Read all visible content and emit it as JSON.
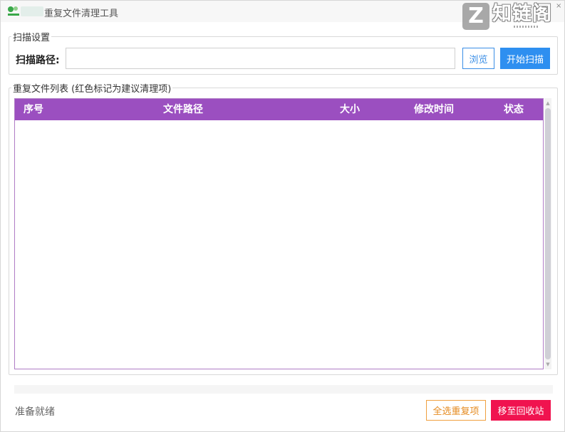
{
  "window": {
    "title": "重复文件清理工具"
  },
  "watermark": {
    "logo_letter": "Z",
    "brand_text": "知链阁"
  },
  "scan_settings": {
    "legend": "扫描设置",
    "path_label": "扫描路径:",
    "path_value": "",
    "browse_label": "浏览",
    "scan_label": "开始扫描"
  },
  "file_list": {
    "legend": "重复文件列表 (红色标记为建议清理项)",
    "columns": [
      "序号",
      "文件路径",
      "大小",
      "修改时间",
      "状态"
    ],
    "rows": []
  },
  "footer": {
    "status_text": "准备就绪",
    "progress": 0,
    "select_all_label": "全选重复项",
    "recycle_label": "移至回收站"
  },
  "colors": {
    "header_bg": "#9b4fc0",
    "scan_button": "#2e8ff0",
    "recycle_button": "#f0134f",
    "select_all_border": "#f0a040"
  }
}
